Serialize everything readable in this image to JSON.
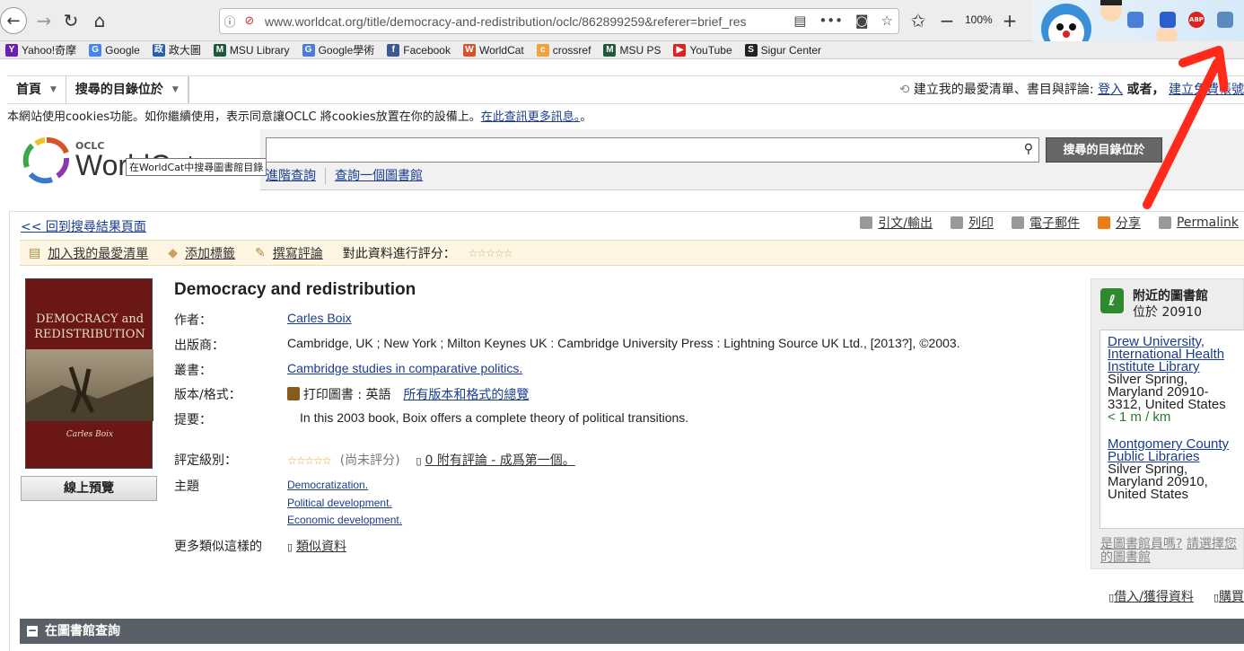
{
  "browser": {
    "url": "www.worldcat.org/title/democracy-and-redistribution/oclc/862899259&referer=brief_res",
    "zoom": "100%",
    "bookmarks": [
      {
        "label": "Yahoo!奇摩",
        "color": "#6a1fb5",
        "glyph": "Y"
      },
      {
        "label": "Google",
        "color": "#4285f4",
        "glyph": "G"
      },
      {
        "label": "政大圖",
        "color": "#2a5db0",
        "glyph": "政"
      },
      {
        "label": "MSU Library",
        "color": "#1d5a3a",
        "glyph": "M"
      },
      {
        "label": "Google學術",
        "color": "#4a7bd6",
        "glyph": "G"
      },
      {
        "label": "Facebook",
        "color": "#3b5998",
        "glyph": "f"
      },
      {
        "label": "WorldCat",
        "color": "#d7532a",
        "glyph": "W"
      },
      {
        "label": "crossref",
        "color": "#f1a23c",
        "glyph": "c"
      },
      {
        "label": "MSU PS",
        "color": "#1d5a3a",
        "glyph": "M"
      },
      {
        "label": "YouTube",
        "color": "#e02020",
        "glyph": "▶"
      },
      {
        "label": "Sigur Center",
        "color": "#222222",
        "glyph": "S"
      }
    ]
  },
  "nav": {
    "home": "首頁",
    "scope": "搜尋的目錄位於",
    "create_prompt": "建立我的最愛清單、書目與評論:",
    "login": "登入",
    "or": "或者，",
    "signup": "建立免費帳號"
  },
  "cookie": {
    "text": "本網站使用cookies功能。如你繼續使用，表示同意讓OCLC 將cookies放置在你的設備上。",
    "link": "在此查訊更多訊息。",
    "end": "。"
  },
  "header": {
    "logo_small": "OCLC",
    "logo_big": "WorldCat",
    "tooltip": "在WorldCat中搜尋圖書館目錄",
    "search_placeholder": "",
    "search_button": "搜尋的目錄位於",
    "advanced": "進階查詢",
    "find_library": "查詢一個圖書館"
  },
  "record": {
    "back": "<< 回到搜尋結果頁面",
    "share": [
      {
        "label": "引文/輸出",
        "icon": "cite-icon"
      },
      {
        "label": "列印",
        "icon": "print-icon"
      },
      {
        "label": "電子郵件",
        "icon": "email-icon"
      },
      {
        "label": "分享",
        "icon": "share-icon"
      },
      {
        "label": "Permalink",
        "icon": "link-icon"
      }
    ],
    "actions": {
      "add_list": "加入我的最愛清單",
      "add_tag": "添加標籤",
      "write_review": "撰寫評論",
      "rate_prompt": "對此資料進行評分："
    },
    "cover": {
      "title_line1": "DEMOCRACY and",
      "title_line2": "REDISTRIBUTION",
      "author": "Carles Boix"
    },
    "preview": "線上預覽",
    "title": "Democracy and redistribution",
    "fields": {
      "author_label": "作者：",
      "author": "Carles Boix",
      "publisher_label": "出版商：",
      "publisher": "Cambridge, UK ; New York ; Milton Keynes UK : Cambridge University Press : Lightning Source UK Ltd., [2013?], ©2003.",
      "series_label": "叢書：",
      "series": "Cambridge studies in comparative politics.",
      "edition_label": "版本/格式：",
      "edition": "打印圖書 : 英語",
      "all_editions": "所有版本和格式的總覽",
      "summary_label": "提要：",
      "summary": "In this 2003 book, Boix offers a complete theory of political transitions.",
      "rating_label": "評定級別：",
      "rating_note": "(尚未評分)",
      "reviews": "0 附有評論 - 成爲第一個。",
      "subjects_label": "主題",
      "subjects": [
        "Democratization.",
        "Political development.",
        "Economic development."
      ],
      "similar_label": "更多類似這樣的",
      "similar": "類似資料"
    }
  },
  "libraries": {
    "heading": "附近的圖書館",
    "location": "位於 20910",
    "items": [
      {
        "name": "Drew University, International Health Institute Library",
        "address": "Silver Spring, Maryland 20910-3312, United States",
        "distance": "< 1 m / km"
      },
      {
        "name": "Montgomery County Public Libraries",
        "address": "Silver Spring, Maryland 20910, United States",
        "distance": ""
      }
    ],
    "footer_q": "是圖書館員嗎?",
    "footer_link": "請選擇您的圖書館"
  },
  "bottom": {
    "borrow": "借入/獲得資料",
    "buy": "購買",
    "library_section": "在圖書館查詢"
  },
  "colors": {
    "link": "#1a3c8f",
    "annotation_arrow": "#ff2a1a",
    "library_bar": "#5a6068"
  }
}
